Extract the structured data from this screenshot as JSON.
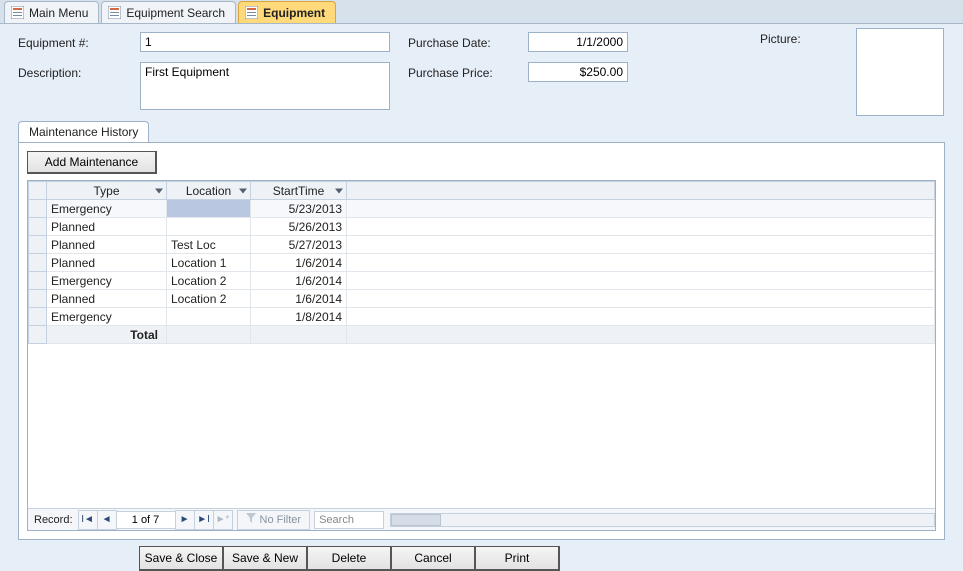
{
  "tabs": [
    {
      "label": "Main Menu",
      "active": false
    },
    {
      "label": "Equipment Search",
      "active": false
    },
    {
      "label": "Equipment",
      "active": true
    }
  ],
  "form": {
    "labels": {
      "equipment_no": "Equipment #:",
      "description": "Description:",
      "purchase_date": "Purchase Date:",
      "purchase_price": "Purchase Price:",
      "picture": "Picture:"
    },
    "values": {
      "equipment_no": "1",
      "description": "First Equipment",
      "purchase_date": "1/1/2000",
      "purchase_price": "$250.00"
    }
  },
  "subform": {
    "tab_label": "Maintenance History",
    "add_button": "Add Maintenance",
    "columns": [
      "Type",
      "Location",
      "StartTime"
    ],
    "rows": [
      {
        "type": "Emergency",
        "location": "",
        "start": "5/23/2013",
        "selected": true
      },
      {
        "type": "Planned",
        "location": "",
        "start": "5/26/2013"
      },
      {
        "type": "Planned",
        "location": "Test Loc",
        "start": "5/27/2013"
      },
      {
        "type": "Planned",
        "location": "Location 1",
        "start": "1/6/2014"
      },
      {
        "type": "Emergency",
        "location": "Location 2",
        "start": "1/6/2014"
      },
      {
        "type": "Planned",
        "location": "Location 2",
        "start": "1/6/2014"
      },
      {
        "type": "Emergency",
        "location": "",
        "start": "1/8/2014"
      }
    ],
    "total_label": "Total"
  },
  "recordnav": {
    "label": "Record:",
    "position": "1 of 7",
    "nofilter": "No Filter",
    "search_placeholder": "Search"
  },
  "actions": {
    "save_close": "Save & Close",
    "save_new": "Save & New",
    "delete": "Delete",
    "cancel": "Cancel",
    "print": "Print"
  }
}
